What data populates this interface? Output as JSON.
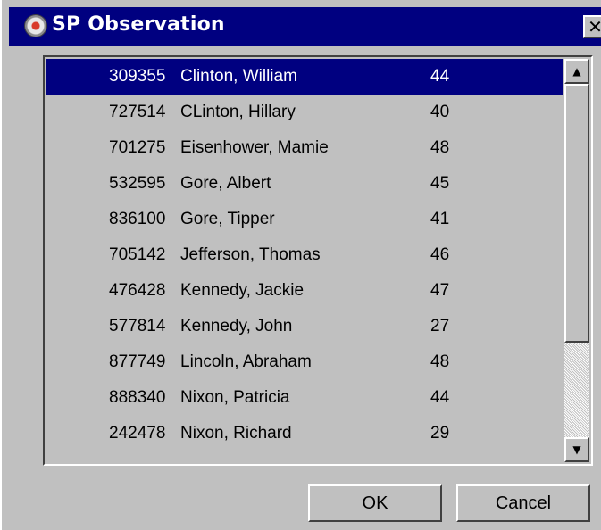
{
  "window": {
    "title": "SP Observation",
    "close_glyph": "✕"
  },
  "list": {
    "rows": [
      {
        "id": "309355",
        "name": "Clinton, William",
        "value": "44",
        "selected": true
      },
      {
        "id": "727514",
        "name": "CLinton, Hillary",
        "value": "40"
      },
      {
        "id": "701275",
        "name": "Eisenhower, Mamie",
        "value": "48"
      },
      {
        "id": "532595",
        "name": "Gore, Albert",
        "value": "45"
      },
      {
        "id": "836100",
        "name": "Gore, Tipper",
        "value": "41"
      },
      {
        "id": "705142",
        "name": "Jefferson, Thomas",
        "value": "46"
      },
      {
        "id": "476428",
        "name": "Kennedy, Jackie",
        "value": "47"
      },
      {
        "id": "577814",
        "name": "Kennedy, John",
        "value": "27"
      },
      {
        "id": "877749",
        "name": "Lincoln, Abraham",
        "value": "48"
      },
      {
        "id": "888340",
        "name": "Nixon, Patricia",
        "value": "44"
      },
      {
        "id": "242478",
        "name": "Nixon, Richard",
        "value": "29"
      }
    ]
  },
  "scrollbar": {
    "up_glyph": "▲",
    "down_glyph": "▼"
  },
  "buttons": {
    "ok_label": "OK",
    "cancel_label": "Cancel"
  },
  "colors": {
    "titlebar": "#000080",
    "selection": "#000080",
    "face": "#c0c0c0"
  }
}
